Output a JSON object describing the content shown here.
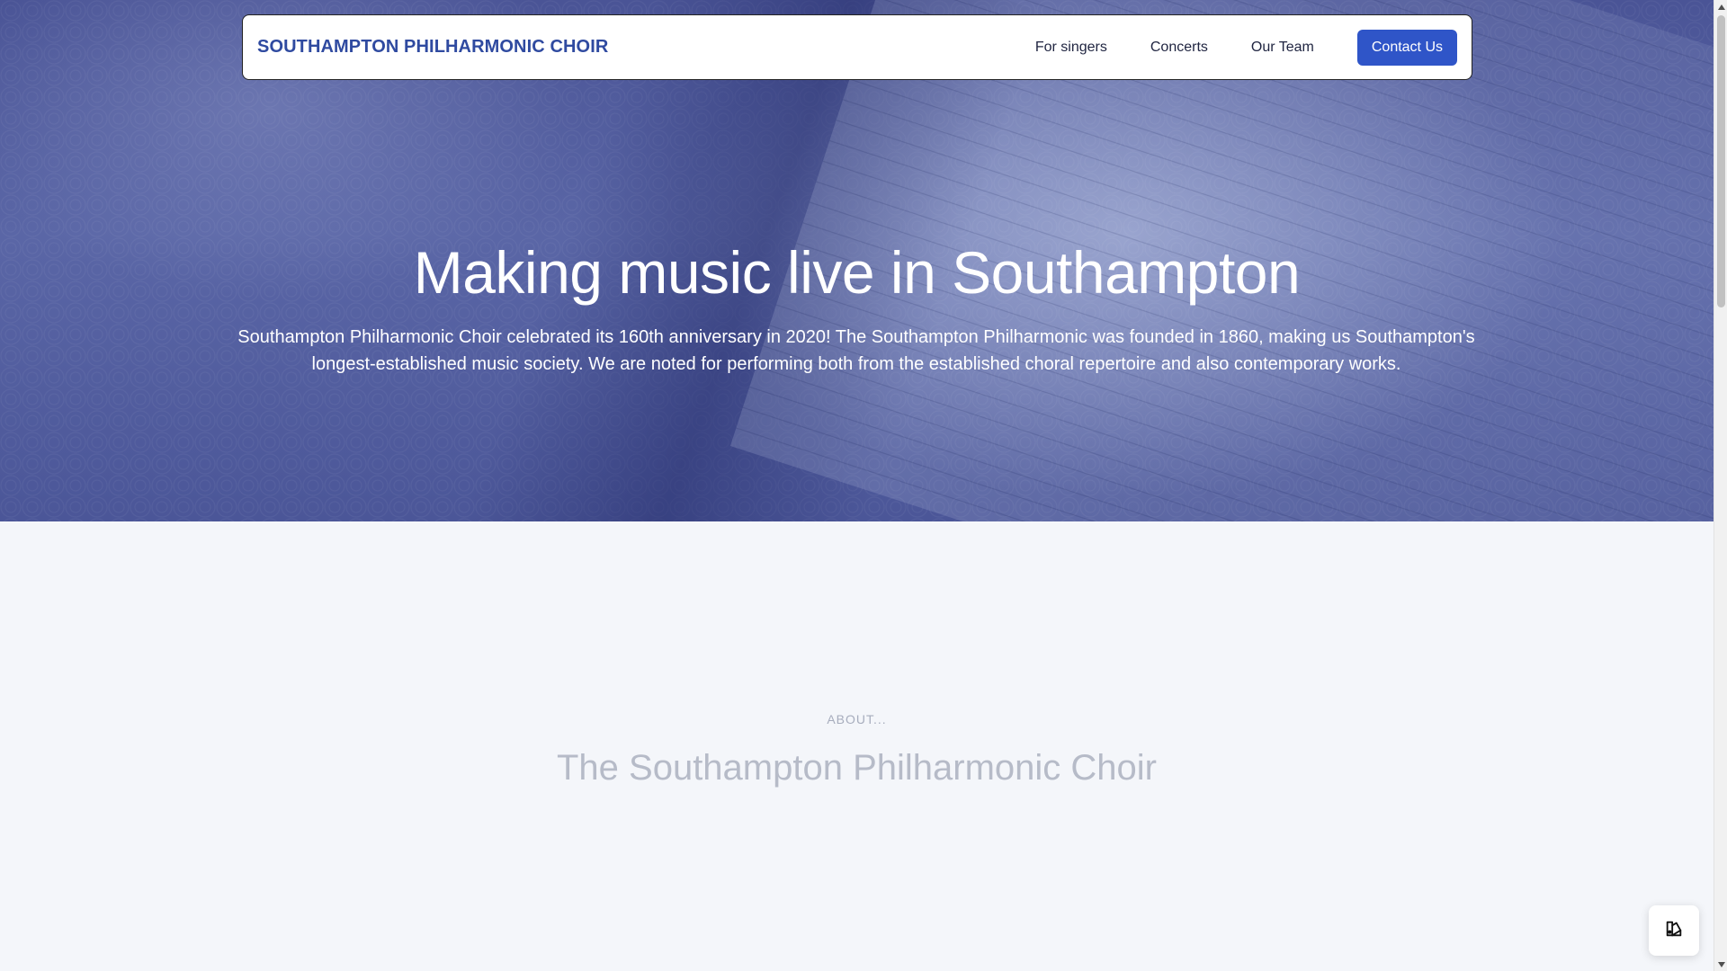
{
  "nav": {
    "brand": "SOUTHAMPTON PHILHARMONIC CHOIR",
    "links": [
      "For singers",
      "Concerts",
      "Our Team"
    ],
    "cta": "Contact Us"
  },
  "hero": {
    "title": "Making music live in Southampton",
    "subtitle": "Southampton Philharmonic Choir celebrated its 160th anniversary in 2020! The Southampton Philharmonic was founded in 1860, making us Southampton's longest-established music society. We are noted for performing both from the established choral repertoire and also contemporary works."
  },
  "about": {
    "eyebrow": "ABOUT...",
    "title": "The Southampton Philharmonic Choir",
    "body": ""
  },
  "widget": {
    "icon": "palette-icon"
  },
  "colors": {
    "brand": "#2f4aa0",
    "button": "#2f55c8",
    "hero_overlay": "#4a5496"
  }
}
